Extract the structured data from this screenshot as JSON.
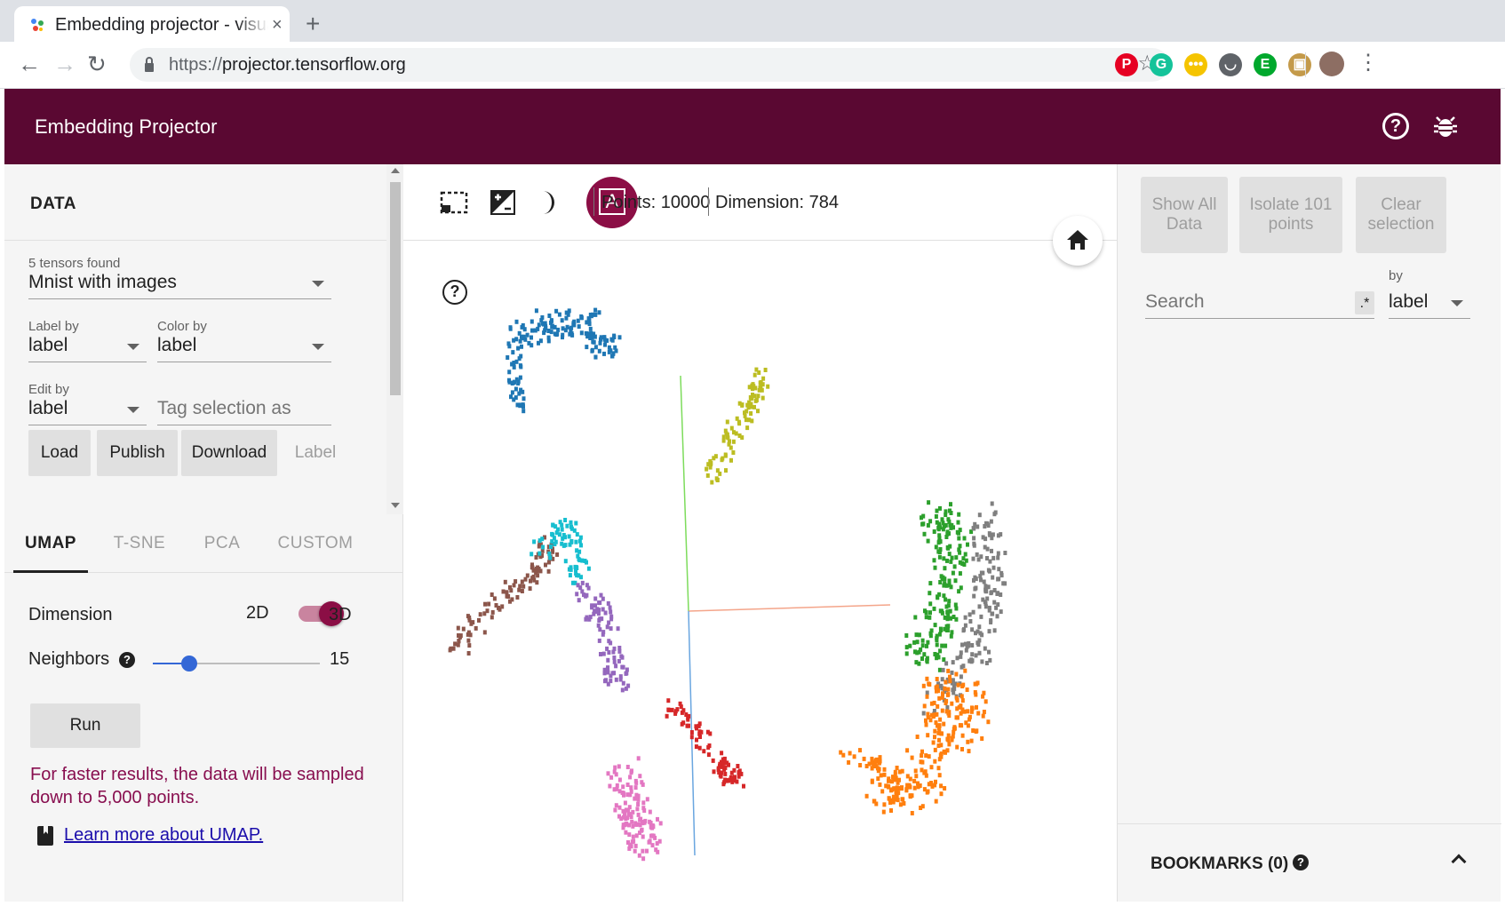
{
  "browser": {
    "tab_title": "Embedding projector - visualization of high-dimensional data",
    "tab_close": "×",
    "new_tab": "+",
    "url_scheme": "https://",
    "url_host": "projector.tensorflow.org",
    "extensions": [
      {
        "icon": "pinterest-icon",
        "color": "#e60023",
        "glyph": "P"
      },
      {
        "icon": "grammarly-icon",
        "color": "#15c39a",
        "glyph": "G"
      },
      {
        "icon": "memo-extension-icon",
        "color": "#f5c400",
        "glyph": "•••"
      },
      {
        "icon": "pocket-icon",
        "color": "#5f6368",
        "glyph": "◡"
      },
      {
        "icon": "evernote-icon",
        "color": "#00a82d",
        "glyph": "E"
      },
      {
        "icon": "briefcase-extension-icon",
        "color": "#c49a4a",
        "glyph": "▣"
      }
    ]
  },
  "header": {
    "title": "Embedding Projector",
    "help_glyph": "?"
  },
  "data_panel": {
    "section_title": "DATA",
    "tensors_found": "5 tensors found",
    "tensor_selected": "Mnist with images",
    "label_by_label": "Label by",
    "label_by_value": "label",
    "color_by_label": "Color by",
    "color_by_value": "label",
    "edit_by_label": "Edit by",
    "edit_by_value": "label",
    "tag_placeholder": "Tag selection as",
    "buttons": {
      "load": "Load",
      "publish": "Publish",
      "download": "Download",
      "label": "Label"
    }
  },
  "projection": {
    "tabs": [
      "UMAP",
      "T-SNE",
      "PCA",
      "CUSTOM"
    ],
    "active_tab": "UMAP",
    "dimension_label": "Dimension",
    "dim_2d": "2D",
    "dim_3d": "3D",
    "dimension_selected": "3D",
    "neighbors_label": "Neighbors",
    "neighbors_help": "?",
    "neighbors_value": "15",
    "run_label": "Run",
    "note": "For faster results, the data will be sampled down to 5,000 points.",
    "learn_more": "Learn more about UMAP."
  },
  "scene": {
    "points_text": "Points: 10000",
    "dimension_text": "Dimension: 784",
    "label_mode_glyph": "A",
    "help_glyph": "?",
    "colors": {
      "0": "#1f77b4",
      "1": "#ff7f0e",
      "2": "#2ca02c",
      "3": "#d62728",
      "4": "#9467bd",
      "5": "#8c564b",
      "6": "#e377c2",
      "7": "#7f7f7f",
      "8": "#bcbd22",
      "9": "#17becf"
    }
  },
  "inspector": {
    "show_all": "Show All Data",
    "isolate": "Isolate 101 points",
    "clear": "Clear selection",
    "search_placeholder": "Search",
    "regex_glyph": ".*",
    "by_label": "by",
    "by_value": "label",
    "bookmarks_title": "BOOKMARKS (0)",
    "bookmarks_help": "?"
  }
}
